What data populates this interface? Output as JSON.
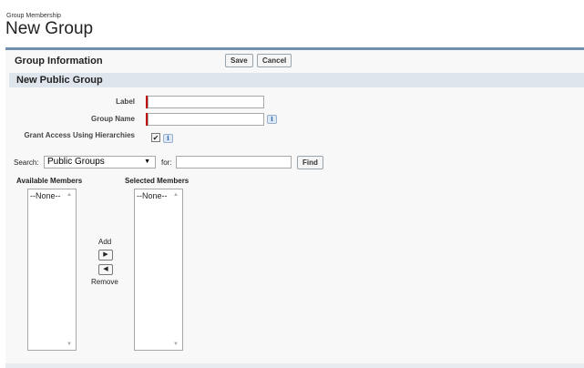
{
  "header": {
    "eyebrow": "Group Membership",
    "title": "New Group"
  },
  "panel": {
    "title": "Group Information",
    "save_label": "Save",
    "cancel_label": "Cancel",
    "section_title": "New Public Group"
  },
  "form": {
    "label_label": "Label",
    "label_value": "",
    "group_name_label": "Group Name",
    "group_name_value": "",
    "grant_access_label": "Grant Access Using Hierarchies",
    "grant_access_checked": true,
    "info_glyph": "i",
    "check_glyph": "✔"
  },
  "search": {
    "search_label": "Search:",
    "selected_option": "Public Groups",
    "for_label": "for:",
    "query": "",
    "find_label": "Find"
  },
  "members": {
    "available_label": "Available Members",
    "available_items": [
      "--None--"
    ],
    "selected_label": "Selected Members",
    "selected_items": [
      "--None--"
    ],
    "add_label": "Add",
    "remove_label": "Remove"
  }
}
